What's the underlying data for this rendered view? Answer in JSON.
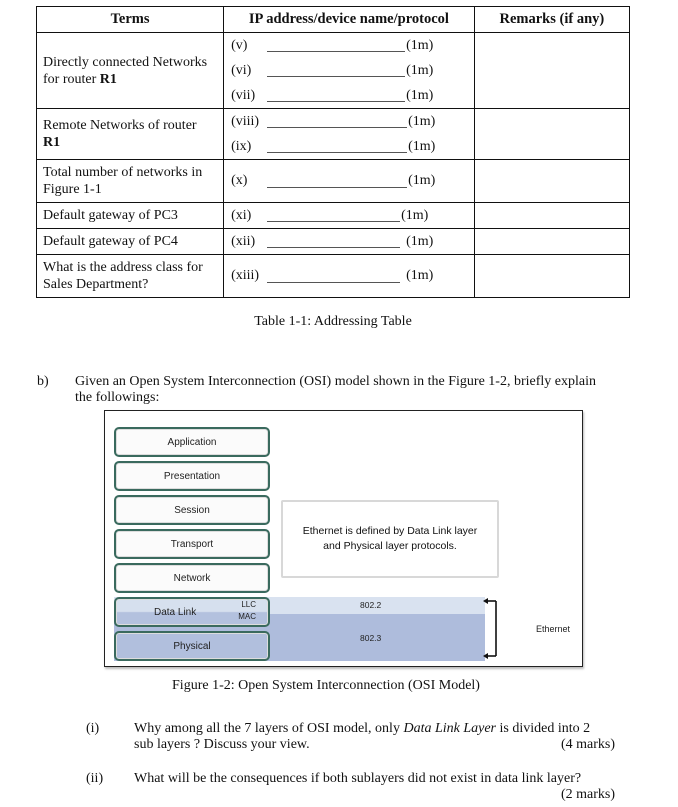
{
  "table": {
    "headers": [
      "Terms",
      "IP address/device name/protocol",
      "Remarks (if any)"
    ],
    "rows": [
      {
        "term": "Directly connected Networks for router ",
        "term_bold": "R1",
        "items": [
          {
            "roman": "(v)",
            "mark": "(1m)"
          },
          {
            "roman": "(vi)",
            "mark": "(1m)"
          },
          {
            "roman": "(vii)",
            "mark": "(1m)"
          }
        ]
      },
      {
        "term": "Remote Networks of router ",
        "term_bold": "R1",
        "items": [
          {
            "roman": "(viii)",
            "mark": "(1m)"
          },
          {
            "roman": "(ix)",
            "mark": "(1m)"
          }
        ]
      },
      {
        "term": "Total number of networks in Figure 1-1",
        "term_bold": "",
        "items": [
          {
            "roman": "(x)",
            "mark": "(1m)"
          }
        ]
      },
      {
        "term": "Default gateway of PC3",
        "term_bold": "",
        "items": [
          {
            "roman": "(xi)",
            "mark": "(1m)"
          }
        ]
      },
      {
        "term": "Default gateway of PC4",
        "term_bold": "",
        "items": [
          {
            "roman": "(xii)",
            "mark": "(1m)"
          }
        ]
      },
      {
        "term": "What is the address class for Sales Department?",
        "term_bold": "",
        "items": [
          {
            "roman": "(xiii)",
            "mark": "(1m)"
          }
        ]
      }
    ],
    "caption": "Table 1-1: Addressing Table"
  },
  "question_b": {
    "label": "b)",
    "text_line1": "Given an Open System Interconnection (OSI) model shown in the Figure 1-2, briefly explain",
    "text_line2": "the followings:"
  },
  "figure": {
    "layers": [
      "Application",
      "Presentation",
      "Session",
      "Transport",
      "Network",
      "Data Link",
      "Physical"
    ],
    "sublayers": [
      "LLC",
      "MAC"
    ],
    "callout_line1": "Ethernet is defined by Data Link layer",
    "callout_line2": "and Physical layer protocols.",
    "standard_upper": "802.2",
    "standard_lower": "802.3",
    "bracket_label": "Ethernet",
    "colors": {
      "layer_border": "#3a6a5e",
      "band_light": "#d9e2f0",
      "band_dark": "#aebcdc"
    },
    "caption": "Figure 1-2: Open System Interconnection (OSI Model)"
  },
  "subquestions": [
    {
      "label": "(i)",
      "line1_pre": "Why among all the 7 layers of OSI model, only ",
      "line1_italic": "Data Link Layer",
      "line1_post": " is divided into 2",
      "line2": "sub layers ? Discuss your view.",
      "marks": "(4 marks)"
    },
    {
      "label": "(ii)",
      "line1_pre": "What will be the consequences if both sublayers did not exist in data link layer?",
      "line1_italic": "",
      "line1_post": "",
      "line2": "",
      "marks": "(2 marks)"
    }
  ]
}
